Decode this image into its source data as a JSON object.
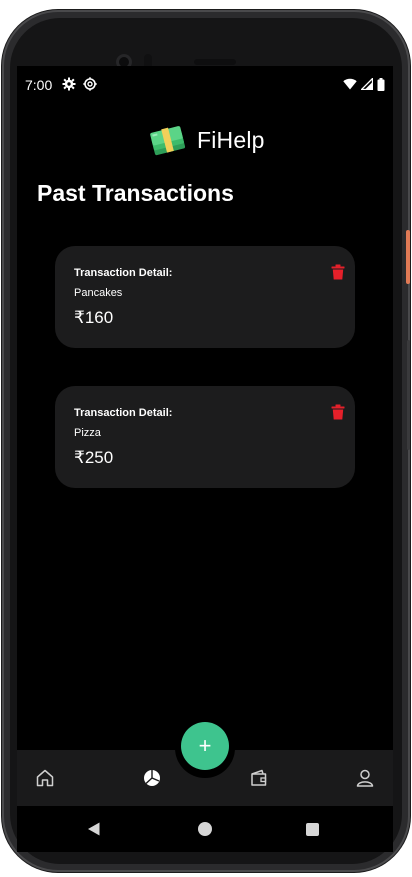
{
  "status_bar": {
    "time": "7:00",
    "left_icons": [
      "settings-gear-icon",
      "settings-cog-icon"
    ],
    "right_icons": [
      "wifi-icon",
      "signal-icon",
      "battery-icon"
    ]
  },
  "app": {
    "name": "FiHelp",
    "logo_icon": "money-stack-icon"
  },
  "page": {
    "title": "Past Transactions"
  },
  "transactions": [
    {
      "detail_label": "Transaction Detail:",
      "item": "Pancakes",
      "amount": "₹160",
      "delete_icon": "trash-icon"
    },
    {
      "detail_label": "Transaction Detail:",
      "item": "Pizza",
      "amount": "₹250",
      "delete_icon": "trash-icon"
    }
  ],
  "fab": {
    "label": "+"
  },
  "bottom_nav": {
    "items": [
      "home-icon",
      "pie-chart-icon",
      "wallet-icon",
      "profile-icon"
    ]
  },
  "system_nav": {
    "items": [
      "back-icon",
      "home-circle-icon",
      "recents-icon"
    ]
  },
  "colors": {
    "accent": "#3ec48e",
    "delete": "#e5202a",
    "card_bg": "#1c1c1d",
    "screen_bg": "#000000"
  }
}
